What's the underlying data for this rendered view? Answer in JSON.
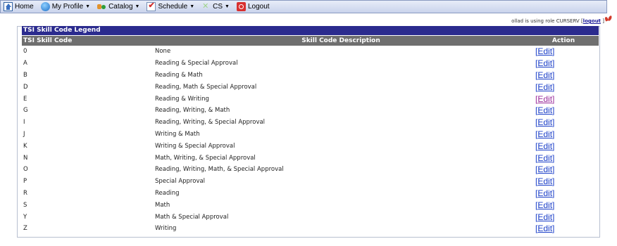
{
  "menu": {
    "items": [
      {
        "label": "Home",
        "icon": "home-icon",
        "dropdown": false
      },
      {
        "label": "My Profile",
        "icon": "profile-icon",
        "dropdown": true
      },
      {
        "label": "Catalog",
        "icon": "catalog-icon",
        "dropdown": true
      },
      {
        "label": "Schedule",
        "icon": "schedule-icon",
        "dropdown": true
      },
      {
        "label": "CS",
        "icon": "cs-icon",
        "dropdown": true
      },
      {
        "label": "Logout",
        "icon": "logout-icon",
        "dropdown": false
      }
    ]
  },
  "role": {
    "text": "ollad is using role CURSERV [",
    "logout_label": "logout",
    "suffix": " ]"
  },
  "legend": {
    "title": "TSI Skill Code Legend",
    "columns": {
      "code": "TSI Skill Code",
      "description": "Skill Code Description",
      "action": "Action"
    },
    "edit_open": "[",
    "edit_label": "Edit",
    "edit_close": "]",
    "rows": [
      {
        "code": "0",
        "description": "None"
      },
      {
        "code": "A",
        "description": "Reading & Special Approval"
      },
      {
        "code": "B",
        "description": "Reading & Math"
      },
      {
        "code": "D",
        "description": "Reading, Math & Special Approval"
      },
      {
        "code": "E",
        "description": "Reading & Writing"
      },
      {
        "code": "G",
        "description": "Reading, Writing, & Math"
      },
      {
        "code": "I",
        "description": "Reading, Writing, & Special Approval"
      },
      {
        "code": "J",
        "description": "Writing & Math"
      },
      {
        "code": "K",
        "description": "Writing & Special Approval"
      },
      {
        "code": "N",
        "description": "Math, Writing, & Special Approval"
      },
      {
        "code": "O",
        "description": "Reading, Writing, Math, & Special Approval"
      },
      {
        "code": "P",
        "description": "Special Approval"
      },
      {
        "code": "R",
        "description": "Reading"
      },
      {
        "code": "S",
        "description": "Math"
      },
      {
        "code": "Y",
        "description": "Math & Special Approval"
      },
      {
        "code": "Z",
        "description": "Writing"
      }
    ]
  },
  "colors": {
    "header_bar": "#2b2b8e",
    "column_header": "#6f6f6f",
    "link": "#1a3ec8",
    "visited_link": "#9a2a9a"
  }
}
